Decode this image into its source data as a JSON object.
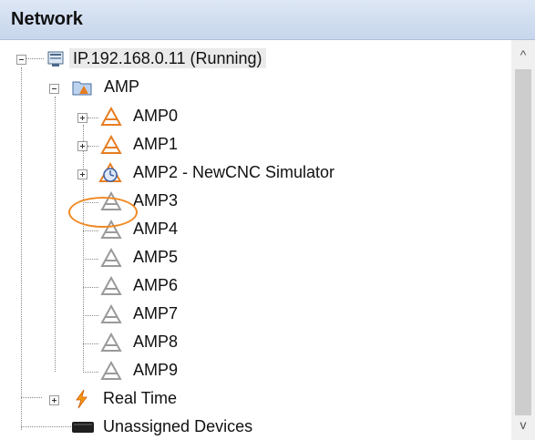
{
  "panel": {
    "title": "Network"
  },
  "tree": {
    "root": {
      "label": "IP.192.168.0.11 (Running)",
      "icon": "computer-icon"
    },
    "amp_group": {
      "label": "AMP",
      "icon": "folder-icon"
    },
    "amps": [
      {
        "label": "AMP0",
        "state": "active"
      },
      {
        "label": "AMP1",
        "state": "active"
      },
      {
        "label": "AMP2 - NewCNC Simulator",
        "state": "simulator"
      },
      {
        "label": "AMP3",
        "state": "inactive"
      },
      {
        "label": "AMP4",
        "state": "inactive"
      },
      {
        "label": "AMP5",
        "state": "inactive"
      },
      {
        "label": "AMP6",
        "state": "inactive"
      },
      {
        "label": "AMP7",
        "state": "inactive"
      },
      {
        "label": "AMP8",
        "state": "inactive"
      },
      {
        "label": "AMP9",
        "state": "inactive"
      }
    ],
    "realtime": {
      "label": "Real Time",
      "icon": "lightning-icon"
    },
    "unassigned": {
      "label": "Unassigned Devices",
      "icon": "device-icon"
    }
  },
  "scrollbar": {
    "up_glyph": "^",
    "down_glyph": "v"
  },
  "colors": {
    "accent": "#f08a24",
    "title_bg": "#c7d6ec",
    "amp_active": "#e67e22",
    "amp_inactive": "#9a9a9a"
  }
}
